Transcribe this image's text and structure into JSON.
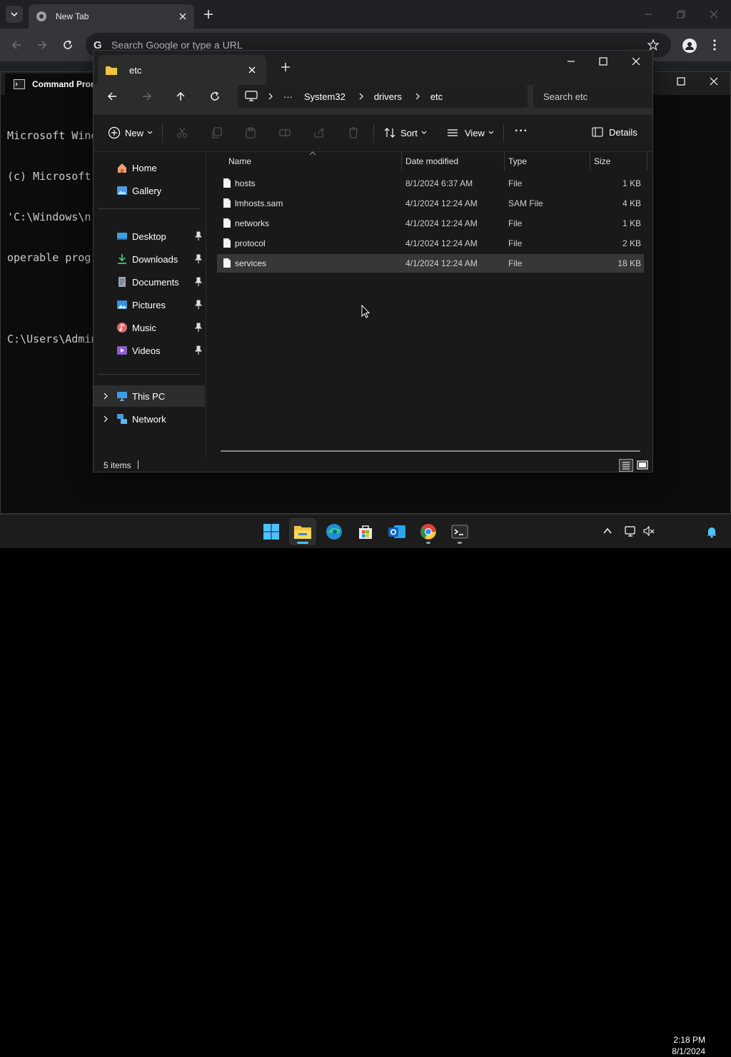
{
  "chrome": {
    "tab_title": "New Tab",
    "omnibox_placeholder": "Search Google or type a URL"
  },
  "cmd": {
    "tab_title": "Command Prom",
    "lines": [
      "Microsoft Wind",
      "(c) Microsoft",
      "'C:\\Windows\\n",
      "operable progr",
      "",
      "C:\\Users\\Admin"
    ]
  },
  "explorer": {
    "tab_title": "etc",
    "address": {
      "more": "···",
      "crumbs": [
        "System32",
        "drivers",
        "etc"
      ]
    },
    "search_placeholder": "Search etc",
    "commandbar": {
      "new_label": "New",
      "sort_label": "Sort",
      "view_label": "View",
      "more_label": "···",
      "details_label": "Details"
    },
    "sidebar": {
      "top": [
        {
          "label": "Home",
          "icon": "home-icon"
        },
        {
          "label": "Gallery",
          "icon": "gallery-icon"
        }
      ],
      "quick": [
        {
          "label": "Desktop",
          "icon": "desktop-folder-icon"
        },
        {
          "label": "Downloads",
          "icon": "downloads-folder-icon"
        },
        {
          "label": "Documents",
          "icon": "documents-folder-icon"
        },
        {
          "label": "Pictures",
          "icon": "pictures-folder-icon"
        },
        {
          "label": "Music",
          "icon": "music-folder-icon"
        },
        {
          "label": "Videos",
          "icon": "videos-folder-icon"
        }
      ],
      "bottom": [
        {
          "label": "This PC",
          "icon": "this-pc-icon"
        },
        {
          "label": "Network",
          "icon": "network-icon"
        }
      ]
    },
    "columns": {
      "name": "Name",
      "date": "Date modified",
      "type": "Type",
      "size": "Size"
    },
    "files": [
      {
        "name": "hosts",
        "date": "8/1/2024 6:37 AM",
        "type": "File",
        "size": "1 KB"
      },
      {
        "name": "lmhosts.sam",
        "date": "4/1/2024 12:24 AM",
        "type": "SAM File",
        "size": "4 KB"
      },
      {
        "name": "networks",
        "date": "4/1/2024 12:24 AM",
        "type": "File",
        "size": "1 KB"
      },
      {
        "name": "protocol",
        "date": "4/1/2024 12:24 AM",
        "type": "File",
        "size": "2 KB"
      },
      {
        "name": "services",
        "date": "4/1/2024 12:24 AM",
        "type": "File",
        "size": "18 KB"
      }
    ],
    "status": "5 items"
  },
  "taskbar": {
    "time": "2:18 PM",
    "date": "8/1/2024",
    "apps": [
      "windows-start-icon",
      "file-explorer-icon",
      "edge-icon",
      "microsoft-store-icon",
      "outlook-icon",
      "chrome-icon",
      "terminal-icon"
    ]
  },
  "colors": {
    "accent": "#4cc2ff",
    "folder": "#f7c23e",
    "selection": "#373737"
  }
}
